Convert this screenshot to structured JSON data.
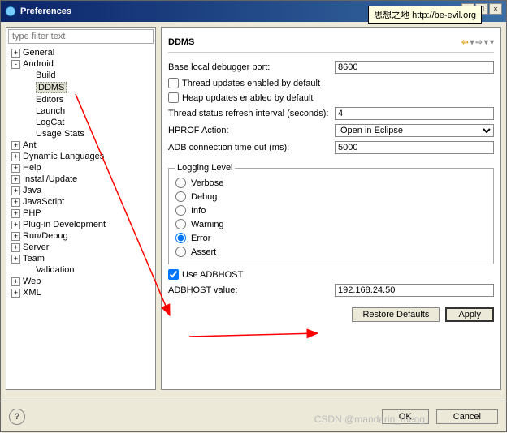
{
  "window": {
    "title": "Preferences"
  },
  "tooltip": "思想之地 http://be-evil.org",
  "sidebar": {
    "filter_placeholder": "type filter text",
    "items": [
      {
        "label": "General",
        "level": 0,
        "exp": "+"
      },
      {
        "label": "Android",
        "level": 0,
        "exp": "-"
      },
      {
        "label": "Build",
        "level": 1,
        "exp": ""
      },
      {
        "label": "DDMS",
        "level": 1,
        "exp": "",
        "selected": true
      },
      {
        "label": "Editors",
        "level": 1,
        "exp": ""
      },
      {
        "label": "Launch",
        "level": 1,
        "exp": ""
      },
      {
        "label": "LogCat",
        "level": 1,
        "exp": ""
      },
      {
        "label": "Usage Stats",
        "level": 1,
        "exp": ""
      },
      {
        "label": "Ant",
        "level": 0,
        "exp": "+"
      },
      {
        "label": "Dynamic Languages",
        "level": 0,
        "exp": "+"
      },
      {
        "label": "Help",
        "level": 0,
        "exp": "+"
      },
      {
        "label": "Install/Update",
        "level": 0,
        "exp": "+"
      },
      {
        "label": "Java",
        "level": 0,
        "exp": "+"
      },
      {
        "label": "JavaScript",
        "level": 0,
        "exp": "+"
      },
      {
        "label": "PHP",
        "level": 0,
        "exp": "+"
      },
      {
        "label": "Plug-in Development",
        "level": 0,
        "exp": "+"
      },
      {
        "label": "Run/Debug",
        "level": 0,
        "exp": "+"
      },
      {
        "label": "Server",
        "level": 0,
        "exp": "+"
      },
      {
        "label": "Team",
        "level": 0,
        "exp": "+"
      },
      {
        "label": "Validation",
        "level": 1,
        "exp": ""
      },
      {
        "label": "Web",
        "level": 0,
        "exp": "+"
      },
      {
        "label": "XML",
        "level": 0,
        "exp": "+"
      }
    ]
  },
  "main": {
    "title": "DDMS",
    "port_label": "Base local debugger port:",
    "port_value": "8600",
    "thread_cb": "Thread updates enabled by default",
    "heap_cb": "Heap updates enabled by default",
    "refresh_label": "Thread status refresh interval (seconds):",
    "refresh_value": "4",
    "hprof_label": "HPROF Action:",
    "hprof_value": "Open in Eclipse",
    "adb_timeout_label": "ADB connection time out (ms):",
    "adb_timeout_value": "5000",
    "logging_legend": "Logging Level",
    "log_levels": [
      "Verbose",
      "Debug",
      "Info",
      "Warning",
      "Error",
      "Assert"
    ],
    "log_selected": "Error",
    "use_adbhost": "Use ADBHOST",
    "adbhost_label": "ADBHOST value:",
    "adbhost_value": "192.168.24.50",
    "restore": "Restore Defaults",
    "apply": "Apply"
  },
  "footer": {
    "ok": "OK",
    "cancel": "Cancel"
  },
  "watermark": "CSDN @mandarin_meng"
}
